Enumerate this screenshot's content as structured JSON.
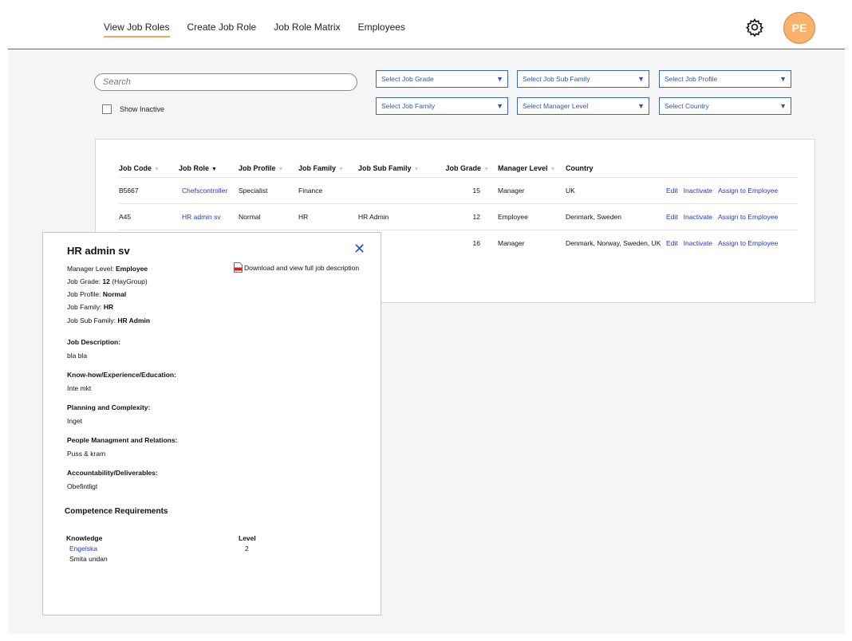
{
  "nav": {
    "tabs": [
      {
        "label": "View Job Roles",
        "active": true
      },
      {
        "label": "Create Job Role"
      },
      {
        "label": "Job Role Matrix"
      },
      {
        "label": "Employees"
      }
    ],
    "avatar_initials": "PE"
  },
  "filters": {
    "search_placeholder": "Search",
    "show_inactive_label": "Show Inactive",
    "selects": [
      "Select Job Grade",
      "Select Job Sub Family",
      "Select Job Profile",
      "Select Job Family",
      "Select Manager Level",
      "Select Country"
    ]
  },
  "table": {
    "columns": [
      "Job Code",
      "Job Role",
      "Job Profile",
      "Job Family",
      "Job Sub Family",
      "Job Grade",
      "Manager Level",
      "Country"
    ],
    "actions": [
      "Edit",
      "Inactivate",
      "Assign to Employee"
    ],
    "rows": [
      {
        "code": "B5667",
        "role": "Chefscontroller",
        "profile": "Specialist",
        "family": "Finance",
        "sub_family": "",
        "grade": "15",
        "manager": "Manager",
        "country": "UK"
      },
      {
        "code": "A45",
        "role": "HR admin sv",
        "profile": "Normal",
        "family": "HR",
        "sub_family": "HR Admin",
        "grade": "12",
        "manager": "Employee",
        "country": "Denmark, Sweden"
      },
      {
        "code": "",
        "role": "",
        "profile": "",
        "family": "",
        "sub_family": "",
        "grade": "16",
        "manager": "Manager",
        "country": "Denmark, Norway, Sweden, UK"
      }
    ]
  },
  "popup": {
    "title": "HR admin sv",
    "download_label": "Download and view full job description",
    "manager_level_label": "Manager Level:",
    "manager_level": "Employee",
    "job_grade_label": "Job Grade:",
    "job_grade": "12",
    "job_grade_suffix": "(HayGroup)",
    "job_profile_label": "Job Profile:",
    "job_profile": "Normal",
    "job_family_label": "Job Family:",
    "job_family": "HR",
    "job_sub_family_label": "Job Sub Family:",
    "job_sub_family": "HR Admin",
    "sections": [
      {
        "heading": "Job Description:",
        "value": "bla bla"
      },
      {
        "heading": "Know-how/Experience/Education:",
        "value": "Inte mkt"
      },
      {
        "heading": "Planning and Complexity:",
        "value": "Inget"
      },
      {
        "heading": "People Managment and Relations:",
        "value": "Puss & kram"
      },
      {
        "heading": "Accountability/Deliverables:",
        "value": "Obefintligt"
      }
    ],
    "competence_heading": "Competence Requirements",
    "knowledge_header": "Knowledge",
    "level_header": "Level",
    "knowledge": [
      {
        "name": "Engelska",
        "level": "2"
      },
      {
        "name": "Smita undan",
        "level": ""
      }
    ]
  },
  "colors": {
    "accent": "#f2a65a",
    "link": "#1f39c9",
    "select_border": "#3b63c4",
    "avatar": "#f8b26a"
  }
}
